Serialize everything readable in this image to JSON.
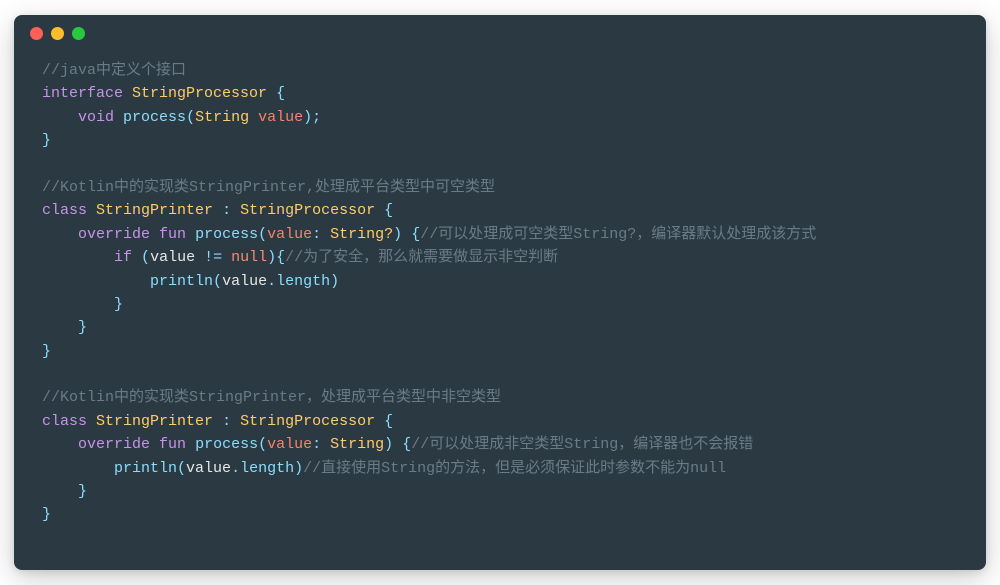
{
  "window": {
    "traffic_colors": {
      "red": "#ff5f56",
      "yellow": "#ffbd2e",
      "green": "#27c93f"
    }
  },
  "code_lines": [
    [
      {
        "c": "comment",
        "t": "//java中定义个接口"
      }
    ],
    [
      {
        "c": "keyword",
        "t": "interface"
      },
      {
        "c": "plain",
        "t": " "
      },
      {
        "c": "type",
        "t": "StringProcessor"
      },
      {
        "c": "plain",
        "t": " "
      },
      {
        "c": "punct",
        "t": "{"
      }
    ],
    [
      {
        "c": "plain",
        "t": "    "
      },
      {
        "c": "keyword",
        "t": "void"
      },
      {
        "c": "plain",
        "t": " "
      },
      {
        "c": "func",
        "t": "process"
      },
      {
        "c": "punct",
        "t": "("
      },
      {
        "c": "type",
        "t": "String"
      },
      {
        "c": "plain",
        "t": " "
      },
      {
        "c": "param",
        "t": "value"
      },
      {
        "c": "punct",
        "t": ");"
      }
    ],
    [
      {
        "c": "punct",
        "t": "}"
      }
    ],
    [],
    [
      {
        "c": "comment",
        "t": "//Kotlin中的实现类StringPrinter,处理成平台类型中可空类型"
      }
    ],
    [
      {
        "c": "keyword",
        "t": "class"
      },
      {
        "c": "plain",
        "t": " "
      },
      {
        "c": "type",
        "t": "StringPrinter"
      },
      {
        "c": "plain",
        "t": " "
      },
      {
        "c": "punct",
        "t": ":"
      },
      {
        "c": "plain",
        "t": " "
      },
      {
        "c": "type",
        "t": "StringProcessor"
      },
      {
        "c": "plain",
        "t": " "
      },
      {
        "c": "punct",
        "t": "{"
      }
    ],
    [
      {
        "c": "plain",
        "t": "    "
      },
      {
        "c": "keyword",
        "t": "override"
      },
      {
        "c": "plain",
        "t": " "
      },
      {
        "c": "keyword",
        "t": "fun"
      },
      {
        "c": "plain",
        "t": " "
      },
      {
        "c": "func",
        "t": "process"
      },
      {
        "c": "punct",
        "t": "("
      },
      {
        "c": "param",
        "t": "value"
      },
      {
        "c": "punct",
        "t": ":"
      },
      {
        "c": "plain",
        "t": " "
      },
      {
        "c": "type",
        "t": "String?"
      },
      {
        "c": "punct",
        "t": ")"
      },
      {
        "c": "plain",
        "t": " "
      },
      {
        "c": "punct",
        "t": "{"
      },
      {
        "c": "comment",
        "t": "//可以处理成可空类型String?，编译器默认处理成该方式"
      }
    ],
    [
      {
        "c": "plain",
        "t": "        "
      },
      {
        "c": "keyword",
        "t": "if"
      },
      {
        "c": "plain",
        "t": " "
      },
      {
        "c": "punct",
        "t": "("
      },
      {
        "c": "ident",
        "t": "value"
      },
      {
        "c": "plain",
        "t": " "
      },
      {
        "c": "punct",
        "t": "!="
      },
      {
        "c": "plain",
        "t": " "
      },
      {
        "c": "null",
        "t": "null"
      },
      {
        "c": "punct",
        "t": "){"
      },
      {
        "c": "comment",
        "t": "//为了安全，那么就需要做显示非空判断"
      }
    ],
    [
      {
        "c": "plain",
        "t": "            "
      },
      {
        "c": "func",
        "t": "println"
      },
      {
        "c": "punct",
        "t": "("
      },
      {
        "c": "ident",
        "t": "value"
      },
      {
        "c": "punct",
        "t": "."
      },
      {
        "c": "prop",
        "t": "length"
      },
      {
        "c": "punct",
        "t": ")"
      }
    ],
    [
      {
        "c": "plain",
        "t": "        "
      },
      {
        "c": "punct",
        "t": "}"
      }
    ],
    [
      {
        "c": "plain",
        "t": "    "
      },
      {
        "c": "punct",
        "t": "}"
      }
    ],
    [
      {
        "c": "punct",
        "t": "}"
      }
    ],
    [],
    [
      {
        "c": "comment",
        "t": "//Kotlin中的实现类StringPrinter，处理成平台类型中非空类型"
      }
    ],
    [
      {
        "c": "keyword",
        "t": "class"
      },
      {
        "c": "plain",
        "t": " "
      },
      {
        "c": "type",
        "t": "StringPrinter"
      },
      {
        "c": "plain",
        "t": " "
      },
      {
        "c": "punct",
        "t": ":"
      },
      {
        "c": "plain",
        "t": " "
      },
      {
        "c": "type",
        "t": "StringProcessor"
      },
      {
        "c": "plain",
        "t": " "
      },
      {
        "c": "punct",
        "t": "{"
      }
    ],
    [
      {
        "c": "plain",
        "t": "    "
      },
      {
        "c": "keyword",
        "t": "override"
      },
      {
        "c": "plain",
        "t": " "
      },
      {
        "c": "keyword",
        "t": "fun"
      },
      {
        "c": "plain",
        "t": " "
      },
      {
        "c": "func",
        "t": "process"
      },
      {
        "c": "punct",
        "t": "("
      },
      {
        "c": "param",
        "t": "value"
      },
      {
        "c": "punct",
        "t": ":"
      },
      {
        "c": "plain",
        "t": " "
      },
      {
        "c": "type",
        "t": "String"
      },
      {
        "c": "punct",
        "t": ")"
      },
      {
        "c": "plain",
        "t": " "
      },
      {
        "c": "punct",
        "t": "{"
      },
      {
        "c": "comment",
        "t": "//可以处理成非空类型String，编译器也不会报错"
      }
    ],
    [
      {
        "c": "plain",
        "t": "        "
      },
      {
        "c": "func",
        "t": "println"
      },
      {
        "c": "punct",
        "t": "("
      },
      {
        "c": "ident",
        "t": "value"
      },
      {
        "c": "punct",
        "t": "."
      },
      {
        "c": "prop",
        "t": "length"
      },
      {
        "c": "punct",
        "t": ")"
      },
      {
        "c": "comment",
        "t": "//直接使用String的方法，但是必须保证此时参数不能为null"
      }
    ],
    [
      {
        "c": "plain",
        "t": "    "
      },
      {
        "c": "punct",
        "t": "}"
      }
    ],
    [
      {
        "c": "punct",
        "t": "}"
      }
    ]
  ]
}
